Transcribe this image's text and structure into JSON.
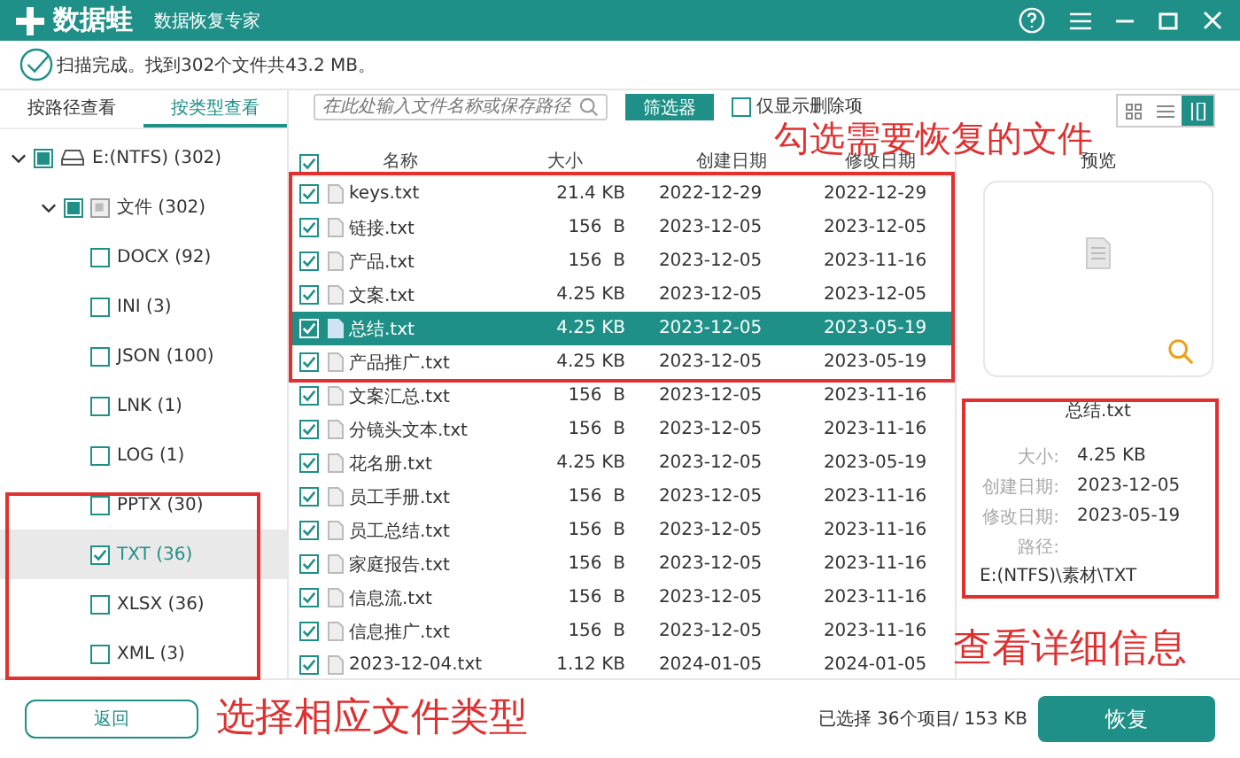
{
  "app": {
    "name": "数据蛙",
    "subtitle": "数据恢复专家"
  },
  "scan_status": "扫描完成。找到302个文件共43.2 MB。",
  "view_tabs": [
    {
      "label": "按路径查看",
      "selected": false
    },
    {
      "label": "按类型查看",
      "selected": true
    }
  ],
  "tree": [
    {
      "label": "E:(NTFS) (302)",
      "kind": "drive",
      "checked": false,
      "partial": true,
      "expanded": true,
      "selected": false,
      "children": [
        {
          "label": "文件 (302)",
          "kind": "folder",
          "checked": false,
          "partial": true,
          "expanded": true,
          "selected": false,
          "children": [
            {
              "label": "DOCX (92)",
              "checked": false,
              "selected": false
            },
            {
              "label": "INI (3)",
              "checked": false,
              "selected": false
            },
            {
              "label": "JSON (100)",
              "checked": false,
              "selected": false
            },
            {
              "label": "LNK (1)",
              "checked": false,
              "selected": false
            },
            {
              "label": "LOG (1)",
              "checked": false,
              "selected": false
            },
            {
              "label": "PPTX (30)",
              "checked": false,
              "selected": false
            },
            {
              "label": "TXT (36)",
              "checked": true,
              "selected": true
            },
            {
              "label": "XLSX (36)",
              "checked": false,
              "selected": false
            },
            {
              "label": "XML (3)",
              "checked": false,
              "selected": false
            }
          ]
        }
      ]
    }
  ],
  "search": {
    "placeholder": "在此处输入文件名称或保存路径"
  },
  "filter_button": "筛选器",
  "deleted_only": {
    "label": "仅显示删除项",
    "checked": false
  },
  "view_modes": [
    {
      "kind": "grid",
      "selected": false
    },
    {
      "kind": "list",
      "selected": false
    },
    {
      "kind": "detail",
      "selected": true
    }
  ],
  "table": {
    "all_checked": true,
    "columns": [
      "名称",
      "大小",
      "创建日期",
      "修改日期"
    ],
    "rows": [
      {
        "name": "keys.txt",
        "size": "21.4 KB",
        "created": "2022-12-29",
        "modified": "2022-12-29",
        "checked": true,
        "selected": false
      },
      {
        "name": "链接.txt",
        "size": "156  B",
        "created": "2023-12-05",
        "modified": "2023-12-05",
        "checked": true,
        "selected": false
      },
      {
        "name": "产品.txt",
        "size": "156  B",
        "created": "2023-12-05",
        "modified": "2023-11-16",
        "checked": true,
        "selected": false
      },
      {
        "name": "文案.txt",
        "size": "4.25 KB",
        "created": "2023-12-05",
        "modified": "2023-12-05",
        "checked": true,
        "selected": false
      },
      {
        "name": "总结.txt",
        "size": "4.25 KB",
        "created": "2023-12-05",
        "modified": "2023-05-19",
        "checked": true,
        "selected": true
      },
      {
        "name": "产品推广.txt",
        "size": "4.25 KB",
        "created": "2023-12-05",
        "modified": "2023-05-19",
        "checked": true,
        "selected": false
      },
      {
        "name": "文案汇总.txt",
        "size": "156  B",
        "created": "2023-12-05",
        "modified": "2023-11-16",
        "checked": true,
        "selected": false
      },
      {
        "name": "分镜头文本.txt",
        "size": "156  B",
        "created": "2023-12-05",
        "modified": "2023-11-16",
        "checked": true,
        "selected": false
      },
      {
        "name": "花名册.txt",
        "size": "4.25 KB",
        "created": "2023-12-05",
        "modified": "2023-05-19",
        "checked": true,
        "selected": false
      },
      {
        "name": "员工手册.txt",
        "size": "156  B",
        "created": "2023-12-05",
        "modified": "2023-11-16",
        "checked": true,
        "selected": false
      },
      {
        "name": "员工总结.txt",
        "size": "156  B",
        "created": "2023-12-05",
        "modified": "2023-11-16",
        "checked": true,
        "selected": false
      },
      {
        "name": "家庭报告.txt",
        "size": "156  B",
        "created": "2023-12-05",
        "modified": "2023-11-16",
        "checked": true,
        "selected": false
      },
      {
        "name": "信息流.txt",
        "size": "156  B",
        "created": "2023-12-05",
        "modified": "2023-11-16",
        "checked": true,
        "selected": false
      },
      {
        "name": "信息推广.txt",
        "size": "156  B",
        "created": "2023-12-05",
        "modified": "2023-11-16",
        "checked": true,
        "selected": false
      },
      {
        "name": "2023-12-04.txt",
        "size": "1.12 KB",
        "created": "2024-01-05",
        "modified": "2024-01-05",
        "checked": true,
        "selected": false
      }
    ]
  },
  "preview": {
    "title": "预览",
    "file_name": "总结.txt",
    "fields": [
      {
        "label": "大小:",
        "value": "4.25 KB"
      },
      {
        "label": "创建日期:",
        "value": "2023-12-05"
      },
      {
        "label": "修改日期:",
        "value": "2023-05-19"
      }
    ],
    "path_label": "路径:",
    "path": "E:(NTFS)\\素材\\TXT"
  },
  "back_button": "返回",
  "selection_summary": "已选择 36个项目/ 153 KB",
  "recover_button": "恢复",
  "annotations": [
    {
      "text": "勾选需要恢复的文件"
    },
    {
      "text": "查看详细信息"
    },
    {
      "text": "选择相应文件类型"
    }
  ]
}
